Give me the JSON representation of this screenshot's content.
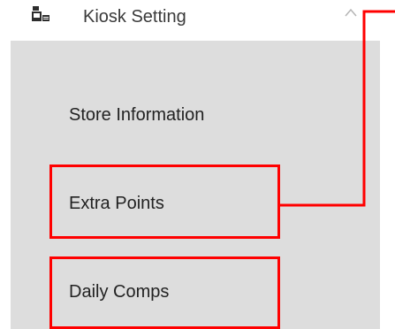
{
  "menu": {
    "header": {
      "label": "Kiosk Setting",
      "icon": "kiosk-icon",
      "expand_icon": "chevron-up-icon"
    },
    "items": [
      {
        "label": "Store Information"
      },
      {
        "label": "Extra Points",
        "highlighted": true
      },
      {
        "label": "Daily Comps",
        "highlighted": true
      }
    ]
  },
  "annotation": {
    "highlight_color": "#ff0000"
  }
}
